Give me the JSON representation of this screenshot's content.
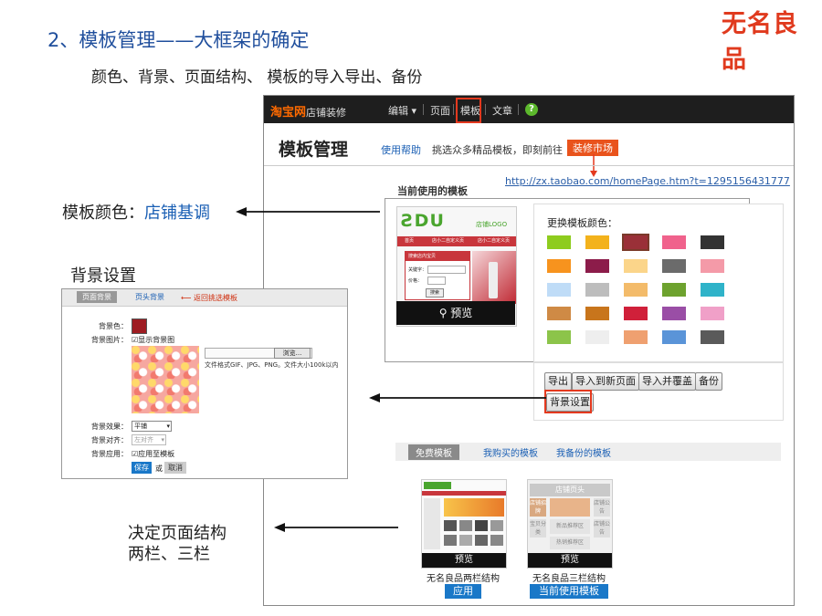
{
  "slide": {
    "title": "2、模板管理——大框架的确定",
    "subtitle": "颜色、背景、页面结构、 模板的导入导出、备份",
    "brand": "无名良品"
  },
  "annotations": {
    "color_prefix": "模板颜色：",
    "color_accent": "店铺基调",
    "background": "背景设置",
    "layout_line1": "决定页面结构",
    "layout_line2": "两栏、三栏"
  },
  "app": {
    "logo": "淘宝网",
    "logo_suffix": "店铺装修",
    "nav": [
      "编辑 ▾",
      "页面",
      "模板",
      "文章"
    ],
    "help_icon": "?",
    "page_title": "模板管理",
    "help_link": "使用帮助",
    "tip": "挑选众多精品模板，即刻前往",
    "market_button": "装修市场",
    "url": "http://zx.taobao.com/homePage.htm?t=1295156431777",
    "current_template_title": "当前使用的模板",
    "thumb": {
      "logo": "ƧDU",
      "logo_text": "店铺LOGO",
      "nav": [
        "首页",
        "店小二自定义页",
        "店小二自定义页"
      ],
      "side_header": "搜索店内宝贝",
      "side_fields": [
        "关键字：",
        "价格："
      ],
      "side_button": "搜索"
    },
    "preview_label": "预览",
    "color_panel_title": "更换模板颜色：",
    "colors": [
      [
        "#8ecc1e",
        "#f3b21c",
        "#9a3038",
        "#f0628c",
        "#333333"
      ],
      [
        "#f7931e",
        "#8c1c4a",
        "#fbd58a",
        "#6b6b6b",
        "#f49aa8"
      ],
      [
        "#bfdcf7",
        "#bdbdbd",
        "#f3bb6a",
        "#6da22e",
        "#2fb3c9"
      ],
      [
        "#cf8a45",
        "#c8751c",
        "#d0203a",
        "#9a4ea6",
        "#f0a0c8"
      ],
      [
        "#8cc44a",
        "#eeeeee",
        "#efa070",
        "#5a94d8",
        "#5a5a5a"
      ]
    ],
    "selected_color_index": [
      0,
      2
    ],
    "actions": [
      "导出",
      "导入到新页面",
      "导入并覆盖",
      "备份"
    ],
    "background_button": "背景设置",
    "tabs": [
      "免费模板",
      "我购买的模板",
      "我备份的模板"
    ],
    "cards": [
      {
        "preview": "预览",
        "name": "无名良品两栏结构",
        "button": "应用"
      },
      {
        "preview": "预览",
        "name": "无名良品三栏结构",
        "button": "当前使用模板"
      }
    ],
    "card3_cells": [
      "店铺页头",
      "店铺招牌",
      "店铺公告",
      "宝贝分类",
      "新品推荐区",
      "店铺公告",
      "热销推荐区"
    ]
  },
  "bg_settings": {
    "tabs": [
      "页面背景",
      "页头背景"
    ],
    "back_link": "返回挑选模板",
    "color_label": "背景色：",
    "image_label": "背景图片：",
    "show_image": "显示背景图",
    "browse": "浏览...",
    "file_note": "文件格式GIF、JPG、PNG。文件大小100k以内",
    "effect_label": "背景效果：",
    "effect_value": "平铺",
    "align_label": "背景对齐：",
    "align_value": "左对齐",
    "apply_label": "背景应用：",
    "apply_value": "应用至模板",
    "save": "保存",
    "or": "或",
    "cancel": "取消"
  }
}
